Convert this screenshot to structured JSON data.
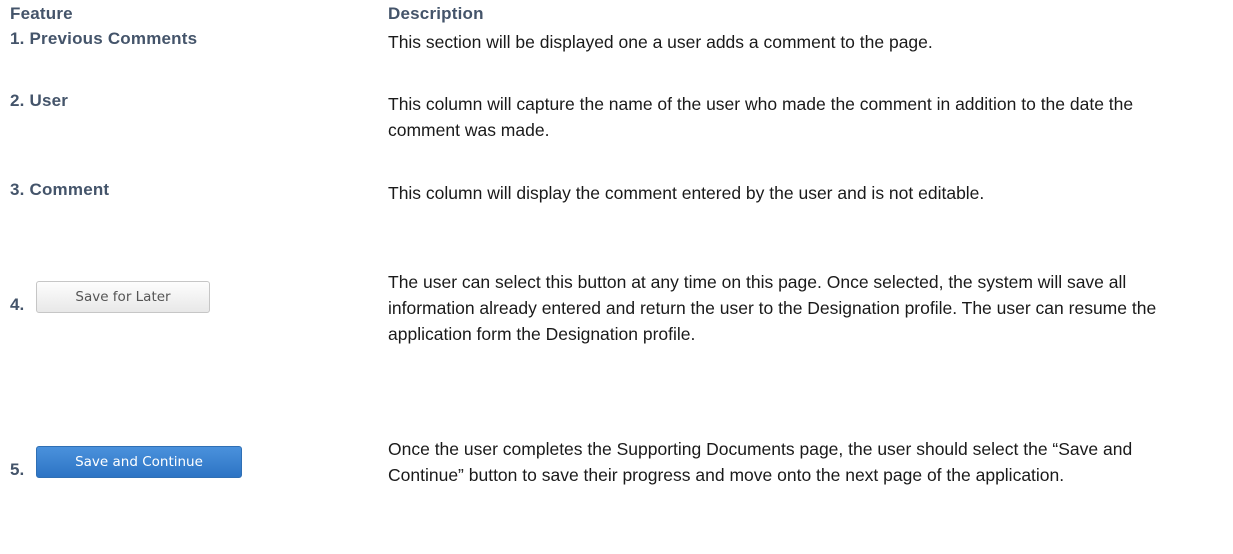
{
  "headers": {
    "feature": "Feature",
    "description": "Description"
  },
  "rows": [
    {
      "feature": "1. Previous Comments",
      "description": "This section will be displayed one a user adds a comment to the page."
    },
    {
      "feature": "2. User",
      "description": "This column will capture the name of the user who made the comment in addition to the date the comment was made."
    },
    {
      "feature": "3. Comment",
      "description": "This column will display the comment entered by the user and is not editable."
    },
    {
      "number": "4.",
      "button_label": "Save for Later",
      "description": "The user can select this button at any time on this page. Once selected, the system will save all information already entered and return the user to the Designation profile. The user can resume the application form the Designation profile."
    },
    {
      "number": "5.",
      "button_label": "Save and Continue",
      "description": "Once the user completes the Supporting Documents page, the user should select the “Save and Continue” button to save their progress and move onto the next page of the application."
    }
  ],
  "colors": {
    "feature_text": "#44546a",
    "body_text": "#1a1a1a",
    "primary_button": "#2d74c4"
  }
}
